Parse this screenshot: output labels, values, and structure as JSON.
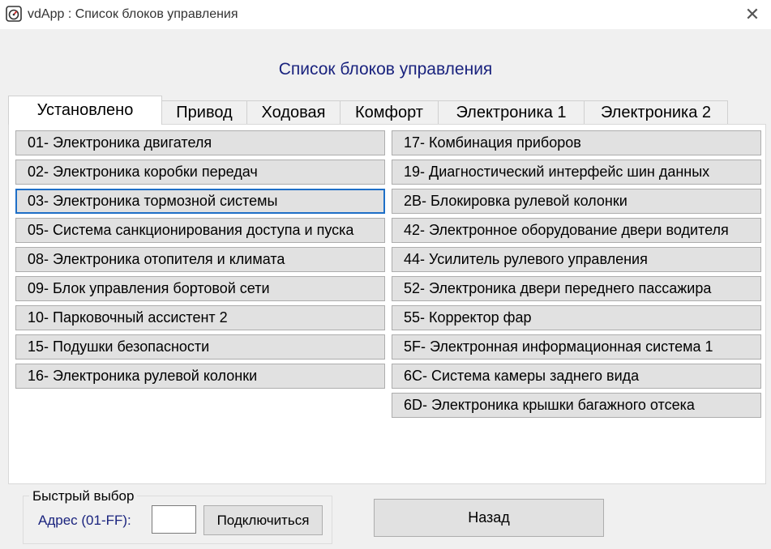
{
  "window": {
    "title": "vdApp :  Список блоков управления",
    "app_icon": "gauge-icon",
    "close_icon": "close-icon",
    "close_glyph": "✕"
  },
  "heading": "Список блоков управления",
  "tabs": [
    {
      "label": "Установлено",
      "active": true
    },
    {
      "label": "Привод",
      "active": false
    },
    {
      "label": "Ходовая",
      "active": false
    },
    {
      "label": "Комфорт",
      "active": false
    },
    {
      "label": "Электроника 1",
      "active": false
    },
    {
      "label": "Электроника 2",
      "active": false
    }
  ],
  "units_left": [
    {
      "label": "01- Электроника двигателя"
    },
    {
      "label": "02- Электроника коробки передач"
    },
    {
      "label": "03- Электроника тормозной системы",
      "focused": true
    },
    {
      "label": "05- Система санкционирования доступа и пуска"
    },
    {
      "label": "08- Электроника отопителя и климата"
    },
    {
      "label": "09- Блок управления бортовой сети"
    },
    {
      "label": "10- Парковочный ассистент 2"
    },
    {
      "label": "15- Подушки безопасности"
    },
    {
      "label": "16- Электроника рулевой колонки"
    }
  ],
  "units_right": [
    {
      "label": "17- Комбинация приборов"
    },
    {
      "label": "19- Диагностический интерфейс шин данных"
    },
    {
      "label": "2B- Блокировка рулевой колонки"
    },
    {
      "label": "42- Электронное оборудование двери водителя"
    },
    {
      "label": "44- Усилитель рулевого управления"
    },
    {
      "label": "52- Электроника двери переднего пассажира"
    },
    {
      "label": "55- Корректор фар"
    },
    {
      "label": "5F- Электронная информационная система 1"
    },
    {
      "label": "6C- Система камеры заднего вида"
    },
    {
      "label": "6D- Электроника крышки багажного отсека"
    }
  ],
  "quick_select": {
    "legend": "Быстрый выбор",
    "address_label": "Адрес (01-FF):",
    "address_value": "",
    "connect_label": "Подключиться"
  },
  "back_label": "Назад",
  "colors": {
    "accent": "#1a237e",
    "focus": "#1e6fc7",
    "button_bg": "#e1e1e1"
  }
}
